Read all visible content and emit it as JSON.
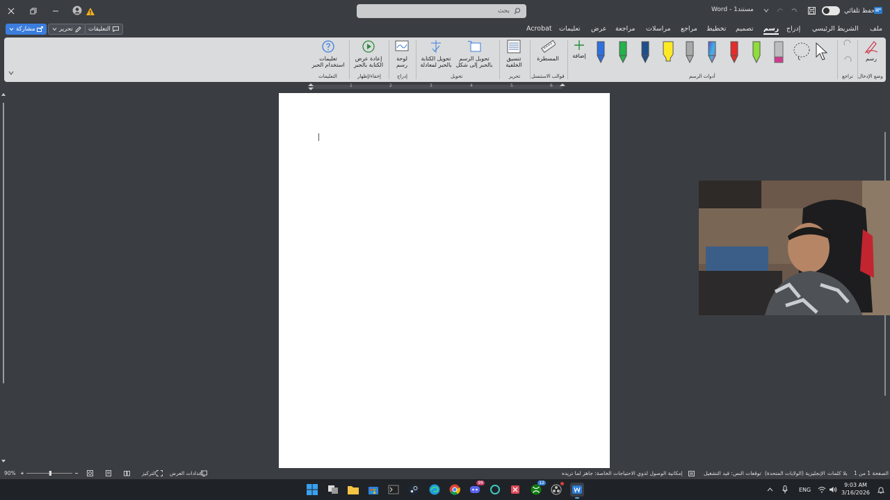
{
  "titlebar": {
    "search_placeholder": "بحث",
    "doc_title": "Word - مستند1",
    "autosave_label": "حفظ تلقائي"
  },
  "menu": {
    "tabs": [
      "ملف",
      "الشريط الرئيسي",
      "إدراج",
      "رسم",
      "تصميم",
      "تخطيط",
      "مراجع",
      "مراسلات",
      "مراجعة",
      "عرض",
      "تعليمات",
      "Acrobat"
    ],
    "active_tab": "رسم",
    "comments_label": "التعليقات",
    "edit_label": "تحرير",
    "share_label": "مشاركة"
  },
  "ribbon": {
    "draw_label": "رسم",
    "add_label": "إضافة",
    "ruler_label": "المسطرة",
    "background_label": "تنسيق الخلفية",
    "ink_to_shape_label": "تحويل الرسم بالحبر إلى شكل",
    "ink_to_math_label": "تحويل الكتابة بالحبر لمعادلة",
    "canvas_label": "لوحة رسم",
    "replay_label": "إعادة عرض الكتابة بالحبر",
    "help_label": "تعليمات استخدام الحبر",
    "groups": {
      "input_mode": "وضع الإدخال",
      "undo": "تراجع",
      "drawing_tools": "أدوات الرسم",
      "stencils": "قوالب الاستنسل",
      "edit": "تحرير",
      "convert": "تحويل",
      "insert": "إدراج",
      "replay": "إخفاء/إظهار",
      "help": "التعليمات"
    }
  },
  "ruler": {
    "ticks": [
      "1",
      "2",
      "3",
      "4",
      "5",
      "6"
    ]
  },
  "statusbar": {
    "page": "الصفحة 1 من 1",
    "words": "بلا كلمات",
    "language": "الإنجليزية (الولايات المتحدة)",
    "predictions": "توقعات النص: قيد التشغيل",
    "accessibility": "إمكانية الوصول لذوي الاحتياجات الخاصة: جاهز لما تريده",
    "display_settings": "إعدادات العرض",
    "focus": "التركيز",
    "zoom": "90%"
  },
  "taskbar": {
    "language": "ENG",
    "time": "9:03 AM",
    "date": "3/16/2026",
    "badge_discord": "99",
    "badge_xbox": "12"
  },
  "colors": {
    "ribbon_bg": "#d9dbdd",
    "app_bg": "#3a3d42",
    "accent": "#3b7ddd",
    "page": "#ffffff"
  }
}
